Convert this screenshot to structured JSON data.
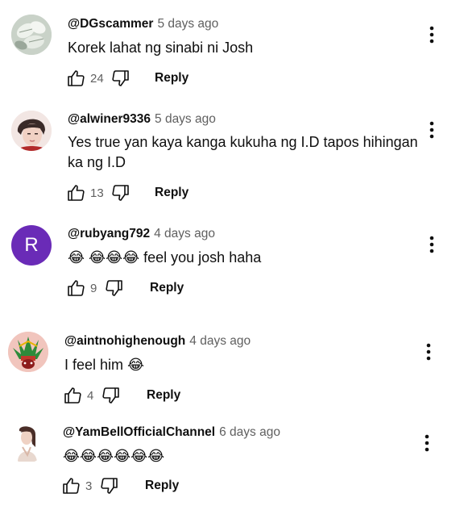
{
  "comments": [
    {
      "handle": "@DGscammer",
      "time": "5 days ago",
      "text": "Korek lahat ng sinabi ni Josh",
      "likes": "24",
      "reply_label": "Reply",
      "avatar": "plant-leaves-avatar"
    },
    {
      "handle": "@alwiner9336",
      "time": "5 days ago",
      "text": "Yes true yan kaya kanga kukuha ng I.D tapos hihingan ka  ng  I.D",
      "likes": "13",
      "reply_label": "Reply",
      "avatar": "person-photo-avatar"
    },
    {
      "handle": "@rubyang792",
      "time": "4 days ago",
      "text": "😂 😂😂😂 feel you josh haha",
      "likes": "9",
      "reply_label": "Reply",
      "avatar_letter": "R",
      "avatar_color": "#6a2bb7"
    },
    {
      "handle": "@aintnohighenough",
      "time": "4 days ago",
      "text": "I feel him 😂",
      "likes": "4",
      "reply_label": "Reply",
      "avatar": "feathered-mask-avatar"
    },
    {
      "handle": "@YamBellOfficialChannel",
      "time": "6 days ago",
      "text": "😂😂😂😂😂😂",
      "likes": "3",
      "reply_label": "Reply",
      "avatar": "woman-portrait-avatar"
    }
  ],
  "icons": {
    "like": "thumbs-up-icon",
    "dislike": "thumbs-down-icon",
    "menu": "more-vert-icon"
  }
}
